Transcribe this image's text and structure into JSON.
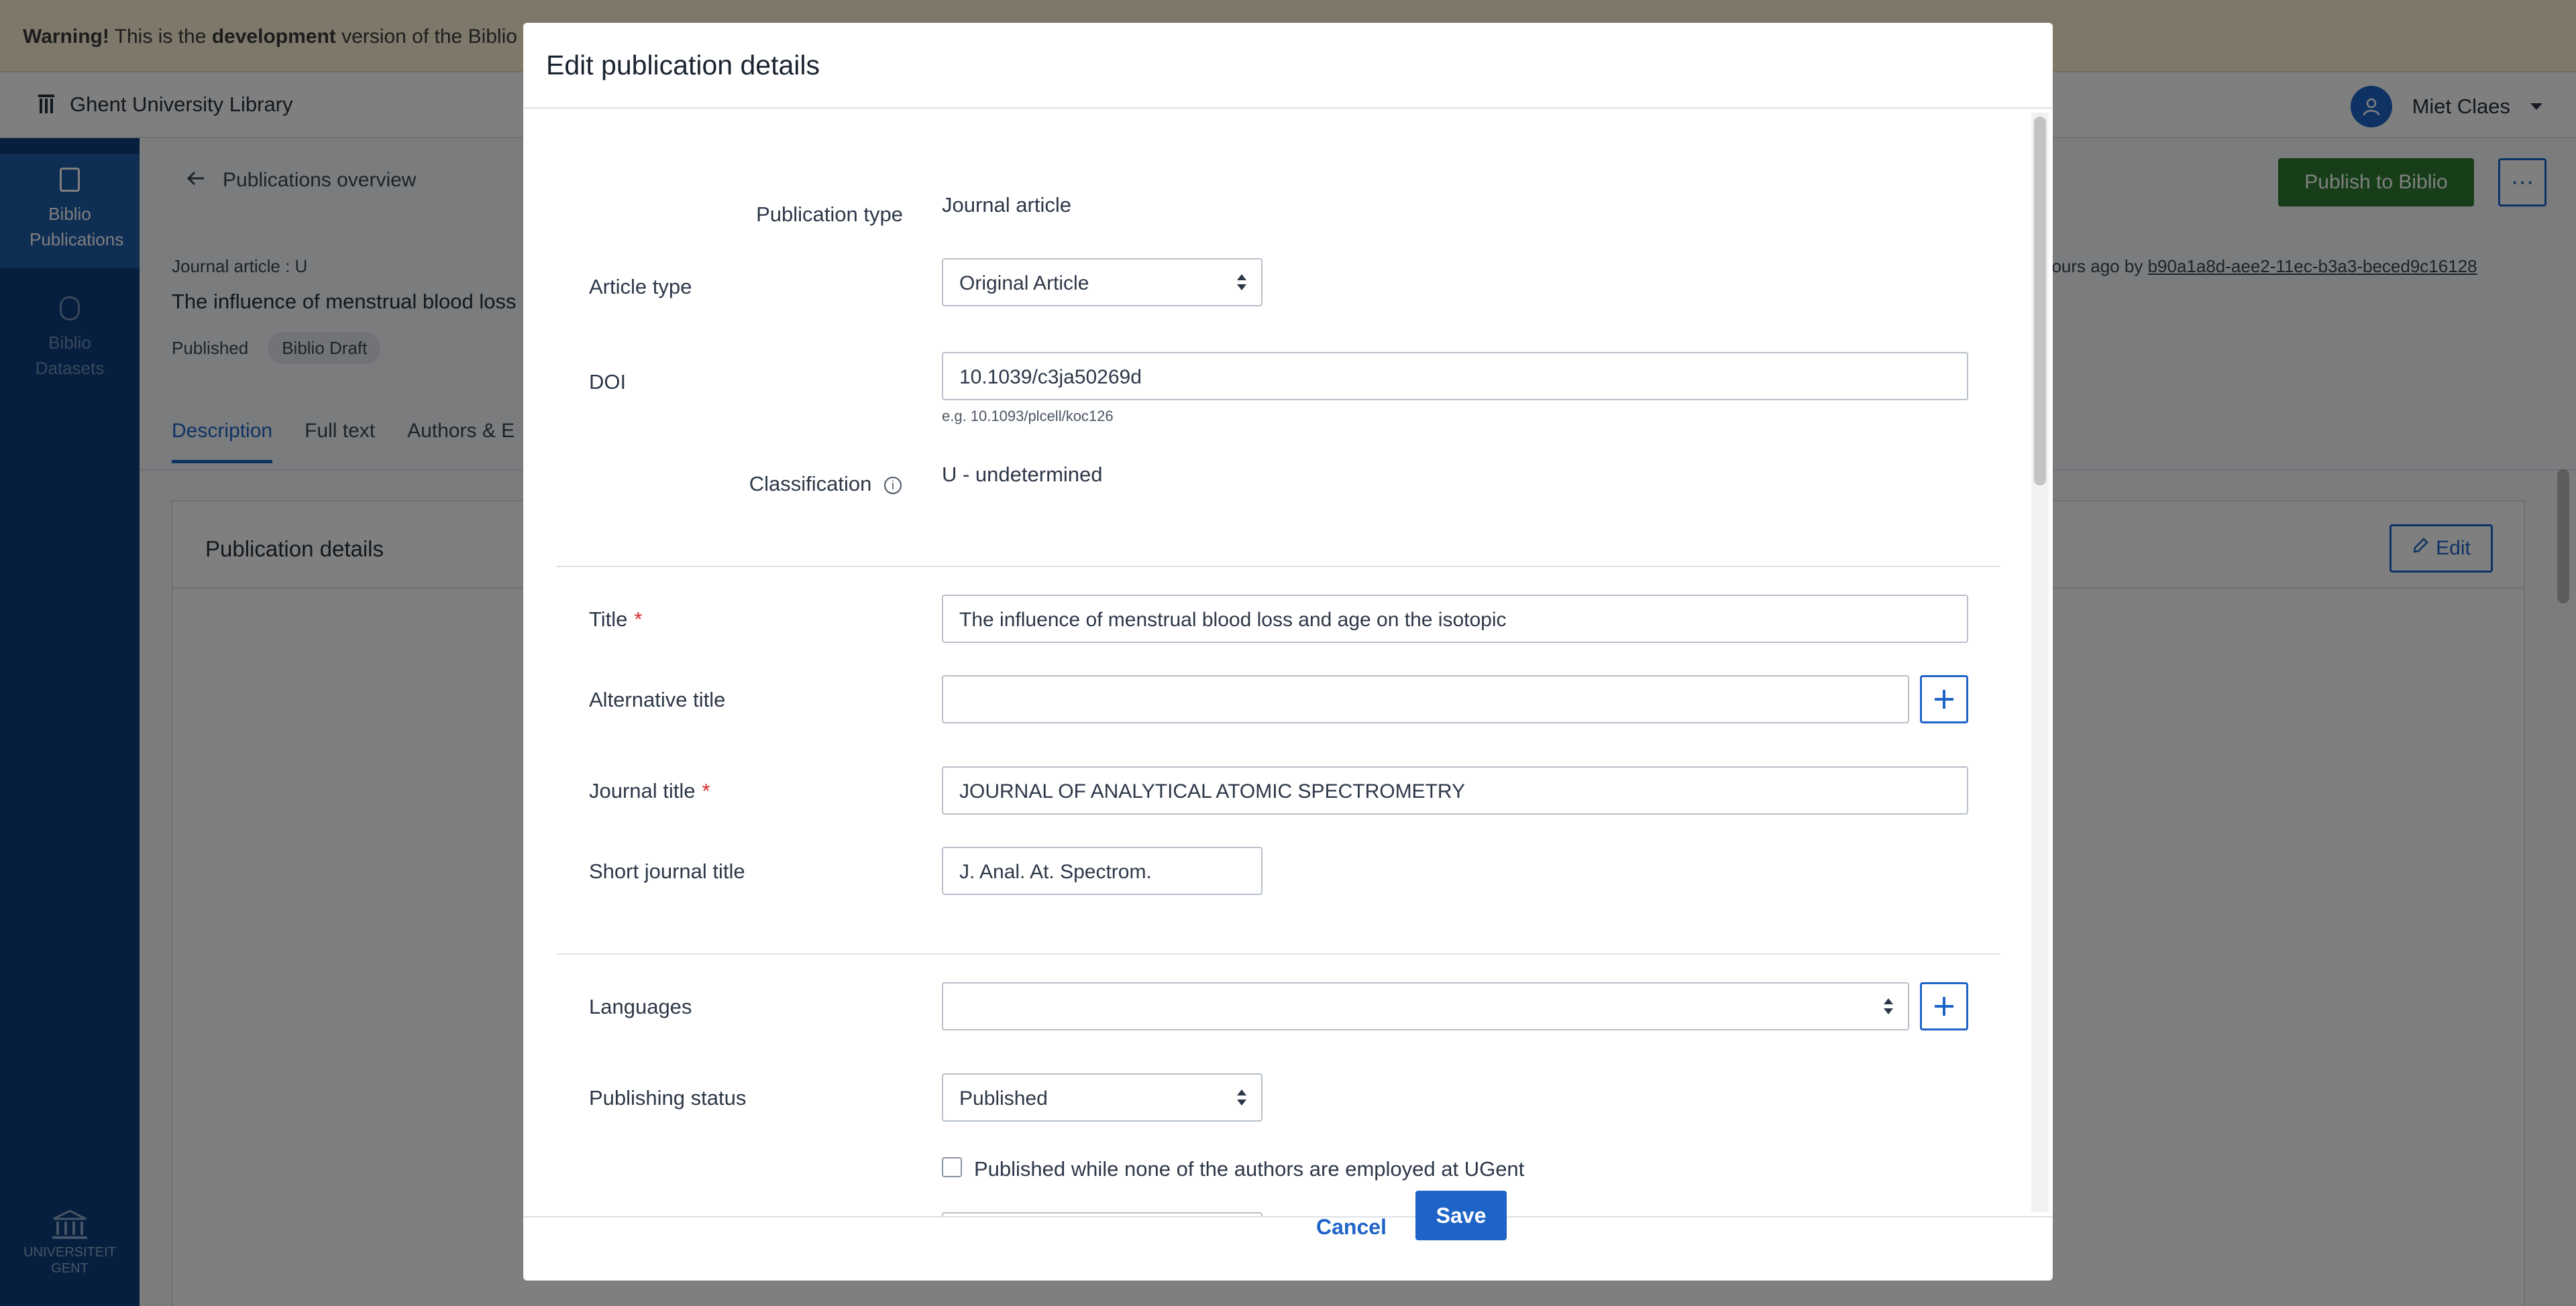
{
  "warning": {
    "strong": "Warning!",
    "text_before": "This is the",
    "strong2": "development",
    "text_after": "version of the Biblio"
  },
  "header": {
    "brand": "Ghent University Library",
    "user_name": "Miet Claes"
  },
  "sidebar": {
    "items": [
      {
        "label": "Biblio Publications"
      },
      {
        "label": "Biblio Datasets"
      }
    ],
    "logo_text": "UNIVERSITEIT GENT"
  },
  "page": {
    "back_label": "Publications overview",
    "publish_label": "Publish to Biblio",
    "more_label": "⋯",
    "type_line": "Journal article : U",
    "title_truncated": "The influence of menstrual blood loss",
    "status": "Published",
    "draft_badge": "Biblio Draft",
    "edited_prefix": "hours ago by",
    "edited_by": "b90a1a8d-aee2-11ec-b3a3-beced9c16128",
    "tabs": [
      "Description",
      "Full text",
      "Authors & E"
    ],
    "panel_title": "Publication details",
    "edit_label": "Edit"
  },
  "modal": {
    "title": "Edit publication details",
    "publication_type_label": "Publication type",
    "publication_type_value": "Journal article",
    "article_type_label": "Article type",
    "article_type_value": "Original Article",
    "doi_label": "DOI",
    "doi_value": "10.1039/c3ja50269d",
    "doi_hint": "e.g. 10.1093/plcell/koc126",
    "classification_label": "Classification",
    "classification_value": "U - undetermined",
    "title_label": "Title",
    "title_value": "The influence of menstrual blood loss and age on the isotopic",
    "alt_title_label": "Alternative title",
    "alt_title_value": "",
    "journal_title_label": "Journal title",
    "journal_title_value": "JOURNAL OF ANALYTICAL ATOMIC SPECTROMETRY",
    "short_journal_label": "Short journal title",
    "short_journal_value": "J. Anal. At. Spectrom.",
    "languages_label": "Languages",
    "languages_value": "",
    "publishing_status_label": "Publishing status",
    "publishing_status_value": "Published",
    "checkbox_label": "Published while none of the authors are employed at UGent",
    "required_mark": "*",
    "cancel_label": "Cancel",
    "save_label": "Save"
  },
  "colors": {
    "primary": "#1e64c8",
    "sidebar": "#0f3f7c",
    "publish_green": "#2e7d32",
    "warning_bg": "#fdf1d7",
    "required": "#d32f2f"
  },
  "icons": [
    "library-icon",
    "user-icon",
    "arrow-left-icon",
    "document-icon",
    "database-icon",
    "pencil-icon",
    "info-icon",
    "plus-icon",
    "university-logo"
  ]
}
